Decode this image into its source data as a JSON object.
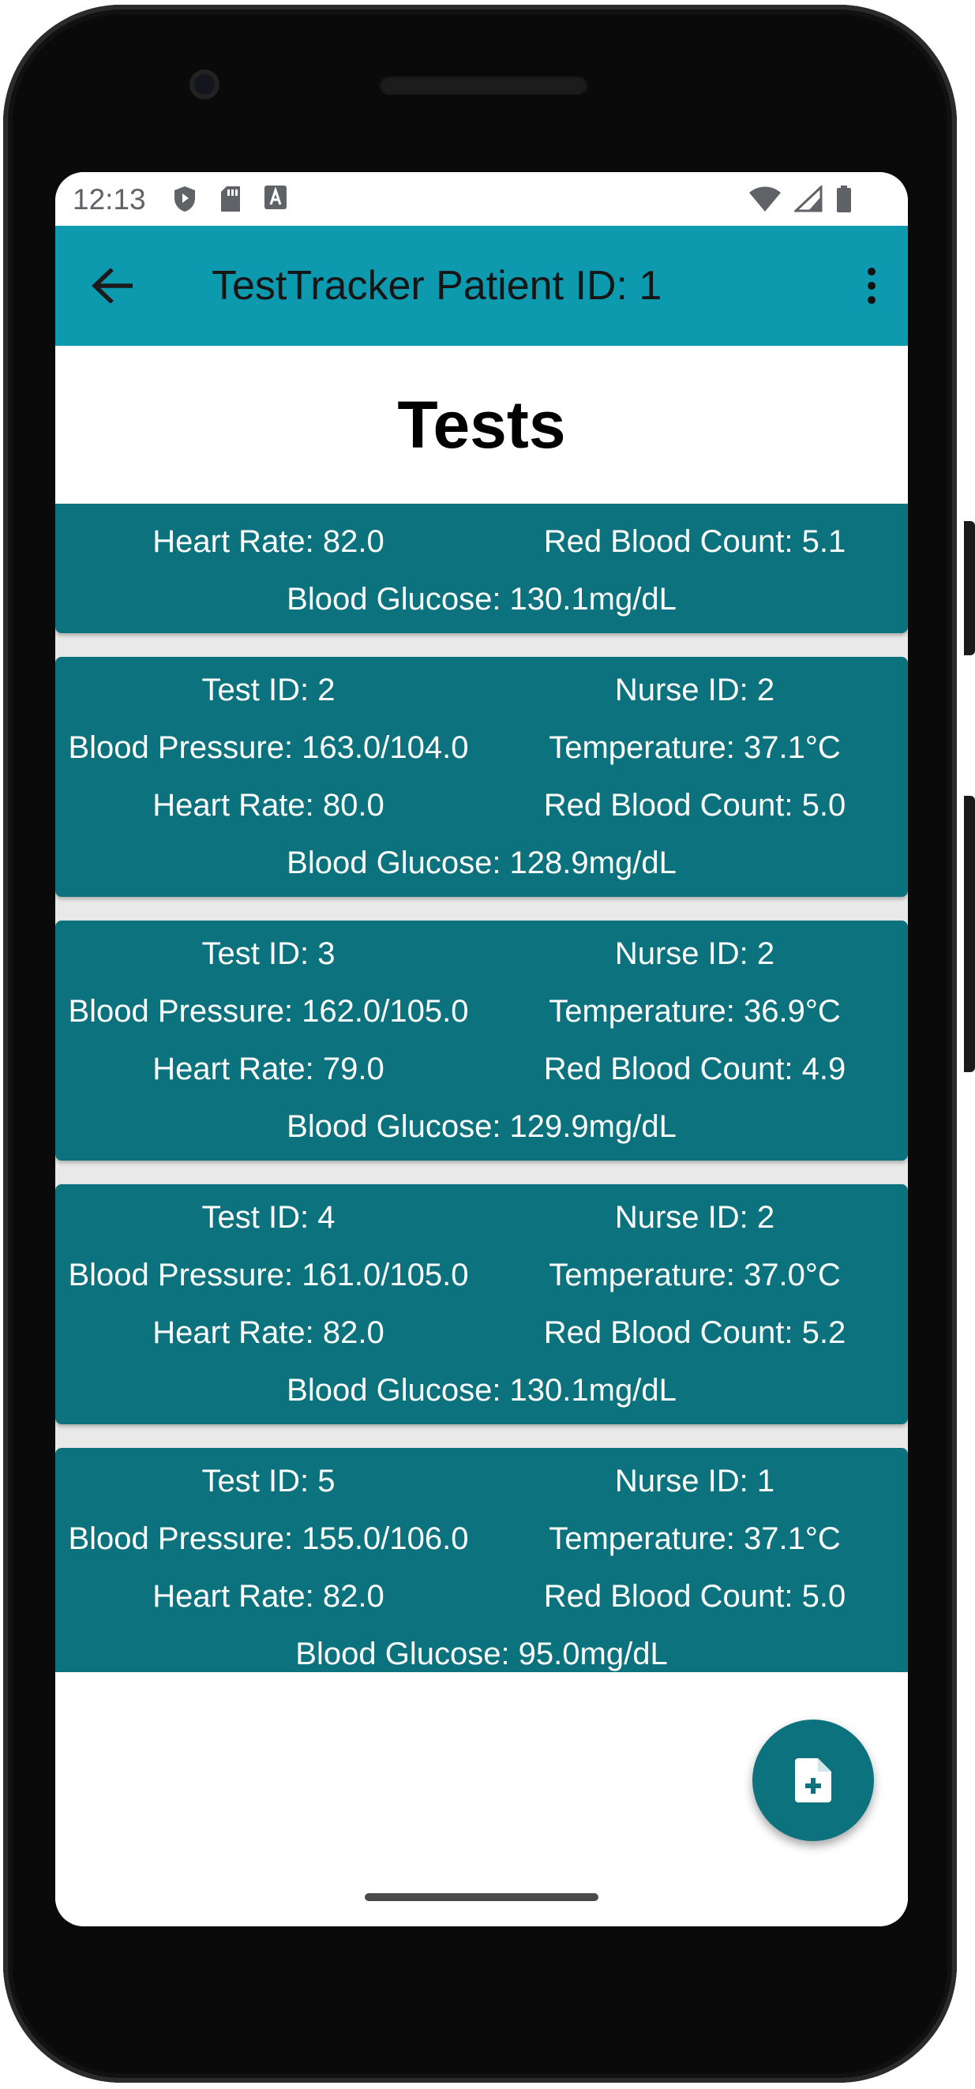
{
  "status_bar": {
    "time": "12:13"
  },
  "app_bar": {
    "title": "TestTracker Patient ID: 1"
  },
  "page": {
    "title": "Tests"
  },
  "tests": [
    {
      "test_id": "",
      "nurse_id": "",
      "blood_pressure": "",
      "temperature": "",
      "heart_rate": "Heart Rate: 82.0",
      "red_blood_count": "Red Blood Count: 5.1",
      "blood_glucose": "Blood Glucose: 130.1mg/dL"
    },
    {
      "test_id": "Test ID: 2",
      "nurse_id": "Nurse ID: 2",
      "blood_pressure": "Blood Pressure: 163.0/104.0",
      "temperature": "Temperature: 37.1°C",
      "heart_rate": "Heart Rate: 80.0",
      "red_blood_count": "Red Blood Count: 5.0",
      "blood_glucose": "Blood Glucose: 128.9mg/dL"
    },
    {
      "test_id": "Test ID: 3",
      "nurse_id": "Nurse ID: 2",
      "blood_pressure": "Blood Pressure: 162.0/105.0",
      "temperature": "Temperature: 36.9°C",
      "heart_rate": "Heart Rate: 79.0",
      "red_blood_count": "Red Blood Count: 4.9",
      "blood_glucose": "Blood Glucose: 129.9mg/dL"
    },
    {
      "test_id": "Test ID: 4",
      "nurse_id": "Nurse ID: 2",
      "blood_pressure": "Blood Pressure: 161.0/105.0",
      "temperature": "Temperature: 37.0°C",
      "heart_rate": "Heart Rate: 82.0",
      "red_blood_count": "Red Blood Count: 5.2",
      "blood_glucose": "Blood Glucose: 130.1mg/dL"
    },
    {
      "test_id": "Test ID: 5",
      "nurse_id": "Nurse ID: 1",
      "blood_pressure": "Blood Pressure: 155.0/106.0",
      "temperature": "Temperature: 37.1°C",
      "heart_rate": "Heart Rate: 82.0",
      "red_blood_count": "Red Blood Count: 5.0",
      "blood_glucose": "Blood Glucose: 95.0mg/dL"
    }
  ],
  "icons": {
    "back": "arrow-back-icon",
    "overflow": "more-vert-icon",
    "fab": "note-add-icon"
  },
  "colors": {
    "app_bar": "#0d9aae",
    "card": "#0c727d",
    "fab": "#0c727d"
  }
}
